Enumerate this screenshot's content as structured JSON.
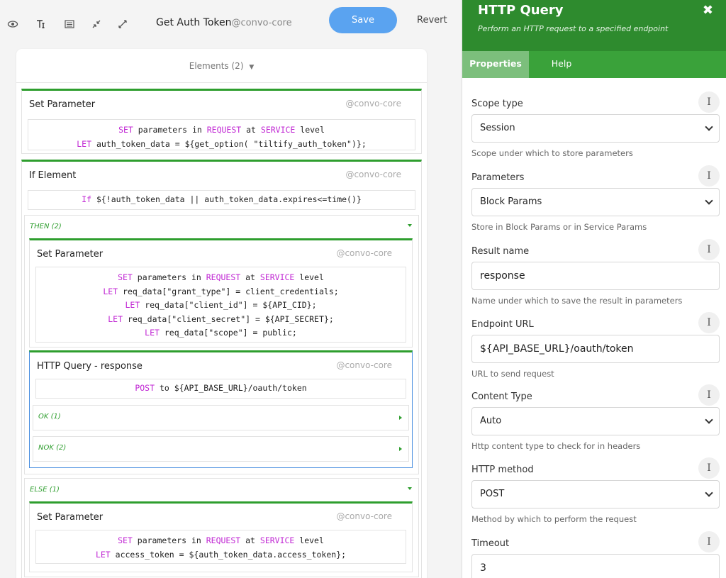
{
  "toolbar": {
    "icons": [
      "eye-icon",
      "text-icon",
      "list-icon",
      "collapse-icon",
      "expand-icon"
    ],
    "title": "Get Auth Token",
    "namespace": "@convo-core",
    "save_label": "Save",
    "revert_label": "Revert"
  },
  "canvas": {
    "elements_label": "Elements (2)",
    "set_param_1": {
      "title": "Set Parameter",
      "ns": "@convo-core",
      "line1": [
        "SET",
        " parameters in ",
        "REQUEST",
        " at ",
        "SERVICE",
        " level"
      ],
      "line2": [
        "LET",
        " auth_token_data = ${get_option( \"tiltify_auth_token\")};"
      ]
    },
    "if_element": {
      "title": "If Element",
      "ns": "@convo-core",
      "condition": [
        "If",
        " ${!auth_token_data || auth_token_data.expires<=time()}"
      ],
      "then_label": "THEN (2)",
      "else_label": "ELSE (1)"
    },
    "set_param_2": {
      "title": "Set Parameter",
      "ns": "@convo-core",
      "line1": [
        "SET",
        " parameters in ",
        "REQUEST",
        " at ",
        "SERVICE",
        " level"
      ],
      "line2": [
        "LET",
        " req_data[\"grant_type\"] = client_credentials;"
      ],
      "line3": [
        "LET",
        " req_data[\"client_id\"] = ${API_CID};"
      ],
      "line4": [
        "LET",
        " req_data[\"client_secret\"] = ${API_SECRET};"
      ],
      "line5": [
        "LET",
        " req_data[\"scope\"] = public;"
      ]
    },
    "http_query": {
      "title": "HTTP Query - response",
      "ns": "@convo-core",
      "line1": [
        "POST",
        " to ${API_BASE_URL}/oauth/token"
      ],
      "ok_label": "OK (1)",
      "nok_label": "NOK (2)"
    },
    "set_param_3": {
      "title": "Set Parameter",
      "ns": "@convo-core",
      "line1": [
        "SET",
        " parameters in ",
        "REQUEST",
        " at ",
        "SERVICE",
        " level"
      ],
      "line2": [
        "LET",
        " access_token = ${auth_token_data.access_token};"
      ]
    }
  },
  "panel": {
    "title": "HTTP Query",
    "subtitle": "Perform an HTTP request to a specified endpoint",
    "close_glyph": "✖",
    "tabs": {
      "properties": "Properties",
      "help": "Help"
    },
    "cursor_glyph": "I",
    "fields": [
      {
        "label": "Scope type",
        "value": "Session",
        "help": "Scope under which to store parameters",
        "kind": "select"
      },
      {
        "label": "Parameters",
        "value": "Block Params",
        "help": "Store in Block Params or in Service Params",
        "kind": "select"
      },
      {
        "label": "Result name",
        "value": "response",
        "help": "Name under which to save the result in parameters",
        "kind": "text"
      },
      {
        "label": "Endpoint URL",
        "value": "${API_BASE_URL}/oauth/token",
        "help": "URL to send request",
        "kind": "text"
      },
      {
        "label": "Content Type",
        "value": "Auto",
        "help": "Http content type to check for in headers",
        "kind": "select"
      },
      {
        "label": "HTTP method",
        "value": "POST",
        "help": "Method by which to perform the request",
        "kind": "select"
      },
      {
        "label": "Timeout",
        "value": "3",
        "help": "",
        "kind": "text"
      }
    ]
  },
  "colors": {
    "accent_green": "#2e8b2e",
    "keyword": "#c026d3",
    "save_blue": "#5aa3f0"
  }
}
